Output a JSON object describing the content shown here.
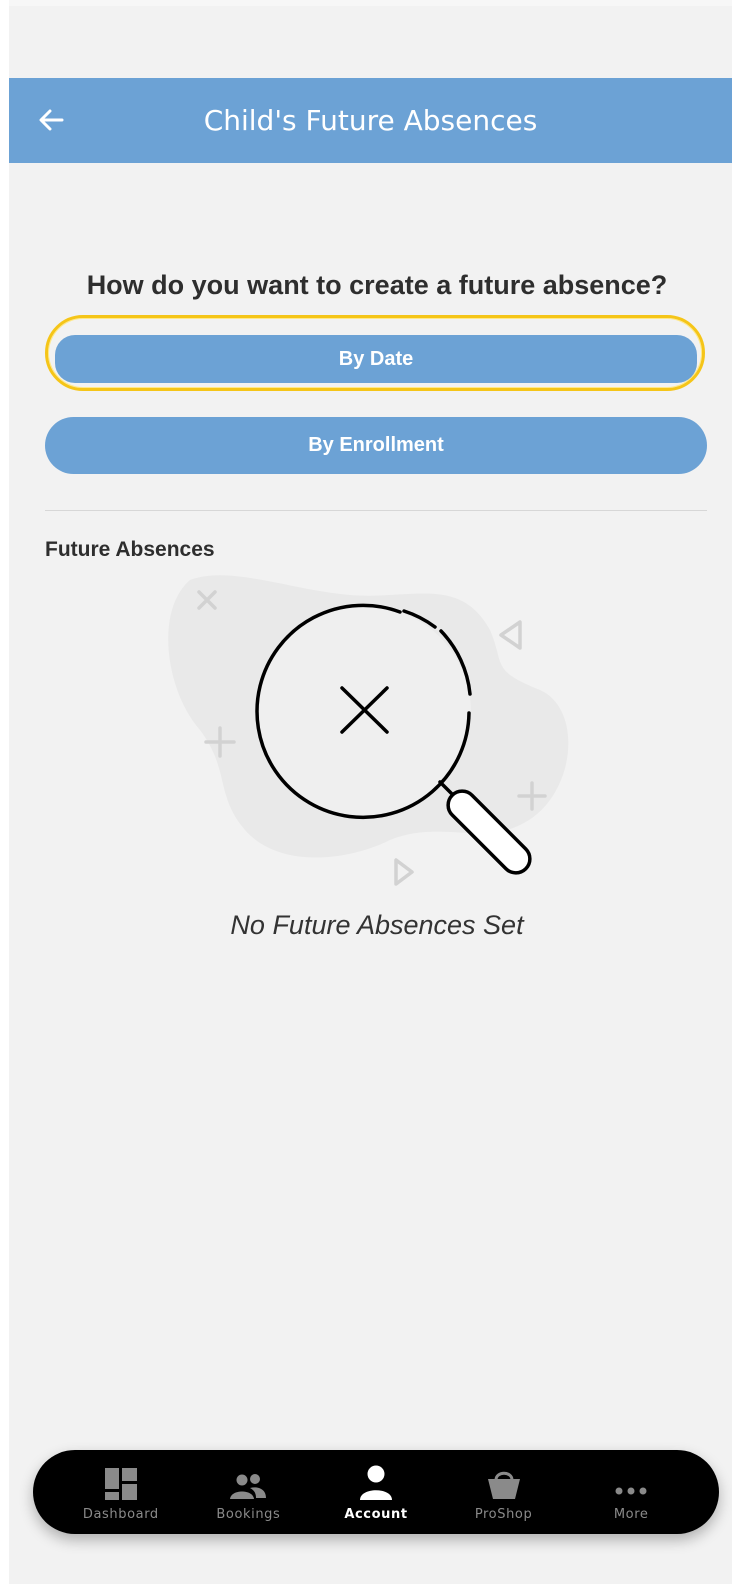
{
  "header": {
    "title": "Child's Future Absences",
    "back_icon": "arrow-left-icon"
  },
  "prompt": {
    "question": "How do you want to create a future absence?"
  },
  "buttons": {
    "by_date": "By Date",
    "by_enrollment": "By Enrollment"
  },
  "section": {
    "title": "Future Absences",
    "empty_icon": "magnifier-not-found-icon",
    "empty_message": "No Future Absences Set"
  },
  "bottom_nav": {
    "items": [
      {
        "label": "Dashboard",
        "icon": "dashboard-icon",
        "active": false
      },
      {
        "label": "Bookings",
        "icon": "people-icon",
        "active": false
      },
      {
        "label": "Account",
        "icon": "person-icon",
        "active": true
      },
      {
        "label": "ProShop",
        "icon": "shopping-basket-icon",
        "active": false
      },
      {
        "label": "More",
        "icon": "more-dots-icon",
        "active": false
      }
    ]
  },
  "colors": {
    "primary": "#6ca2d5",
    "background": "#f2f2f2",
    "focus_ring": "#f5c518",
    "nav_background": "#000000"
  }
}
